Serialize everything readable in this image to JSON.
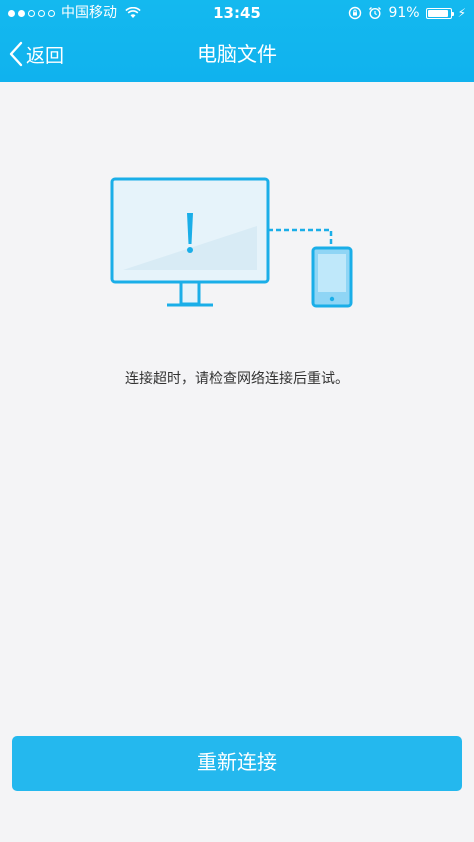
{
  "status_bar": {
    "carrier": "中国移动",
    "time": "13:45",
    "battery_percent": "91%",
    "battery_level": 0.91,
    "signal_icons": [
      "dot-filled",
      "dot-filled",
      "dot-empty",
      "dot-empty",
      "dot-empty"
    ]
  },
  "nav": {
    "back_label": "返回",
    "title": "电脑文件"
  },
  "main": {
    "message": "连接超时，请检查网络连接后重试。",
    "reconnect_label": "重新连接"
  },
  "colors": {
    "accent": "#12b6ef",
    "button": "#24b8ee",
    "background": "#f4f4f6",
    "illustration_fill": "#e6f3fa",
    "illustration_stroke": "#1aaee8"
  }
}
